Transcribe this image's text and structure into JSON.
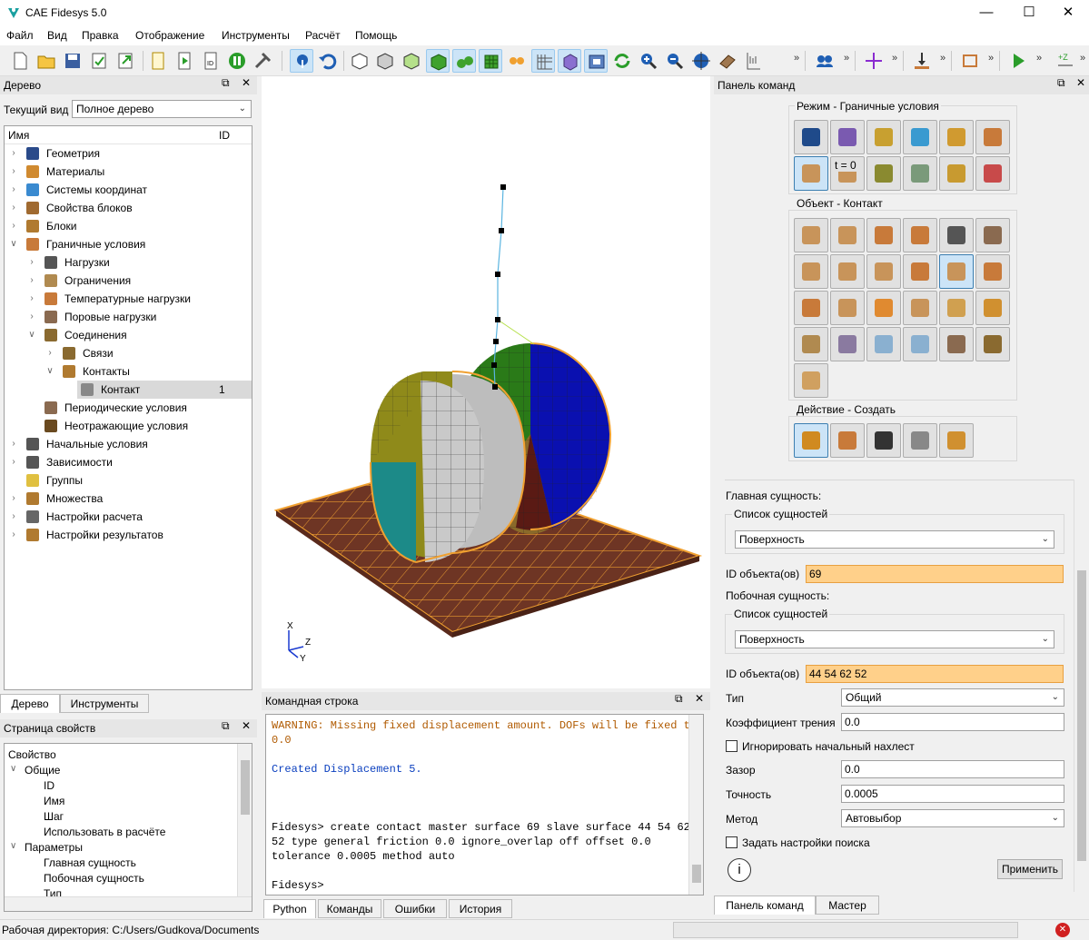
{
  "window": {
    "title": "CAE Fidesys 5.0",
    "min": "—",
    "max": "☐",
    "close": "✕"
  },
  "menu": [
    "Файл",
    "Вид",
    "Правка",
    "Отображение",
    "Инструменты",
    "Расчёт",
    "Помощь"
  ],
  "toolbar": {
    "overflow": "»"
  },
  "tree_panel": {
    "title": "Дерево",
    "current_view_label": "Текущий вид",
    "current_view_value": "Полное дерево",
    "col_name": "Имя",
    "col_id": "ID",
    "items": [
      {
        "label": "Геометрия",
        "id": ""
      },
      {
        "label": "Материалы",
        "id": ""
      },
      {
        "label": "Системы координат",
        "id": ""
      },
      {
        "label": "Свойства блоков",
        "id": ""
      },
      {
        "label": "Блоки",
        "id": ""
      },
      {
        "label": "Граничные условия",
        "id": ""
      },
      {
        "label": "Нагрузки",
        "id": ""
      },
      {
        "label": "Ограничения",
        "id": ""
      },
      {
        "label": "Температурные нагрузки",
        "id": ""
      },
      {
        "label": "Поровые нагрузки",
        "id": ""
      },
      {
        "label": "Соединения",
        "id": ""
      },
      {
        "label": "Связи",
        "id": ""
      },
      {
        "label": "Контакты",
        "id": ""
      },
      {
        "label": "Контакт",
        "id": "1"
      },
      {
        "label": "Периодические условия",
        "id": ""
      },
      {
        "label": "Неотражающие условия",
        "id": ""
      },
      {
        "label": "Начальные условия",
        "id": ""
      },
      {
        "label": "Зависимости",
        "id": ""
      },
      {
        "label": "Группы",
        "id": ""
      },
      {
        "label": "Множества",
        "id": ""
      },
      {
        "label": "Настройки расчета",
        "id": ""
      },
      {
        "label": "Настройки результатов",
        "id": ""
      }
    ],
    "tabs": [
      "Дерево",
      "Инструменты"
    ]
  },
  "props_panel": {
    "title": "Страница свойств",
    "rows": [
      "Свойство",
      "Общие",
      "ID",
      "Имя",
      "Шаг",
      "Использовать в расчёте",
      "Параметры",
      "Главная сущность",
      "Побочная сущность",
      "Тип"
    ]
  },
  "viewport": {
    "axis_x": "X",
    "axis_y": "Y",
    "axis_z": "Z"
  },
  "command_panel": {
    "title": "Командная строка",
    "lines": [
      {
        "text": "WARNING: Missing fixed displacement amount. DOFs will be fixed to 0.0",
        "color": "#b05a00"
      },
      {
        "text": "",
        "color": "#000"
      },
      {
        "text": "Created Displacement 5.",
        "color": "#0a3fbf"
      },
      {
        "text": "",
        "color": "#000"
      },
      {
        "text": "",
        "color": "#000"
      },
      {
        "text": "",
        "color": "#000"
      },
      {
        "text": "Fidesys> create contact master surface 69 slave surface 44 54 62 52 type general friction 0.0 ignore_overlap off offset 0.0 tolerance 0.0005 method auto",
        "color": "#000"
      },
      {
        "text": "",
        "color": "#000"
      },
      {
        "text": "Fidesys> ",
        "color": "#000"
      }
    ],
    "tabs": [
      "Python",
      "Команды",
      "Ошибки",
      "История"
    ]
  },
  "cmd_panel": {
    "title": "Панель команд",
    "mode_group": "Режим - Граничные условия",
    "object_group": "Объект - Контакт",
    "action_group": "Действие - Создать",
    "t0_label": "t = 0",
    "master_label": "Главная сущность:",
    "entity_list_label": "Список сущностей",
    "master_entity": "Поверхность",
    "master_id_label": "ID объекта(ов)",
    "master_id": "69",
    "slave_label": "Побочная сущность:",
    "slave_list_label": "Список сущностей",
    "slave_entity": "Поверхность",
    "slave_id_label": "ID объекта(ов)",
    "slave_id": "44 54 62 52",
    "type_label": "Тип",
    "type_value": "Общий",
    "friction_label": "Коэффициент трения",
    "friction_value": "0.0",
    "ignore_label": "Игнорировать начальный нахлест",
    "gap_label": "Зазор",
    "gap_value": "0.0",
    "tol_label": "Точность",
    "tol_value": "0.0005",
    "method_label": "Метод",
    "method_value": "Автовыбор",
    "search_label": "Задать настройки поиска",
    "apply": "Применить",
    "info": "i",
    "tabs": [
      "Панель команд",
      "Мастер"
    ]
  },
  "status": {
    "workdir": "Рабочая директория: C:/Users/Gudkova/Documents"
  }
}
